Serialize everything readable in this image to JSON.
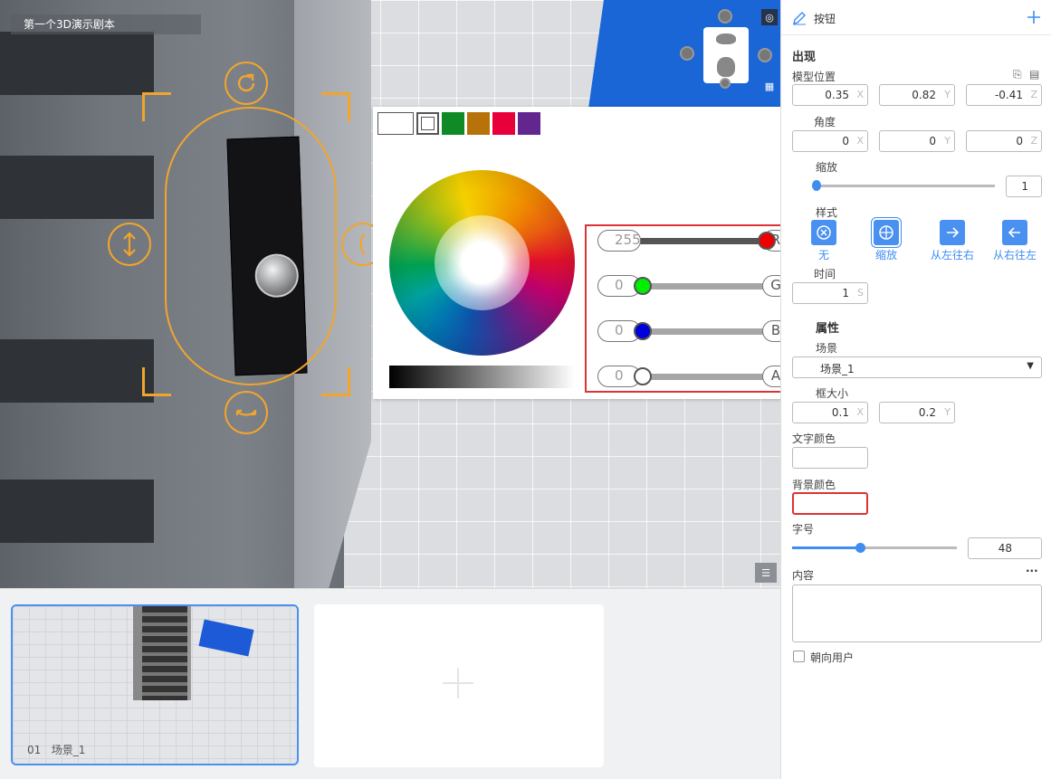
{
  "scene": {
    "title": "第一个3D演示剧本"
  },
  "color_picker": {
    "swatches": [
      "#ffffff",
      "#ffffff",
      "#0f8a26",
      "#b8720a",
      "#e8003a",
      "#62268e"
    ],
    "channels": [
      {
        "value": "255",
        "label": "R",
        "fraction": 1.0,
        "knob_color": "#ee0000"
      },
      {
        "value": "0",
        "label": "G",
        "fraction": 0.0,
        "knob_color": "#00ee00"
      },
      {
        "value": "0",
        "label": "B",
        "fraction": 0.0,
        "knob_color": "#0000dd"
      },
      {
        "value": "0",
        "label": "A",
        "fraction": 0.0,
        "knob_color": "#ffffff"
      }
    ]
  },
  "timeline": {
    "thumbs": [
      {
        "index": "01",
        "name": "场景_1"
      }
    ]
  },
  "panel": {
    "header_title": "按钮",
    "appear_title": "出现",
    "model_position_label": "模型位置",
    "position": {
      "x": "0.35",
      "y": "0.82",
      "z": "-0.41"
    },
    "angle_label": "角度",
    "angle": {
      "x": "0",
      "y": "0",
      "z": "0"
    },
    "scale_label": "缩放",
    "scale_value": "1",
    "scale_fraction": 0.0,
    "style_label": "样式",
    "styles": [
      {
        "label": "无",
        "icon": "cancel-icon"
      },
      {
        "label": "缩放",
        "icon": "move-icon"
      },
      {
        "label": "从左往右",
        "icon": "arrow-right-icon"
      },
      {
        "label": "从右往左",
        "icon": "arrow-left-icon"
      }
    ],
    "time_label": "时间",
    "time_value": "1",
    "time_unit": "S",
    "props_title": "属性",
    "scene_label": "场景",
    "scene_select": "场景_1",
    "box_size_label": "框大小",
    "box_size": {
      "x": "0.1",
      "y": "0.2"
    },
    "text_color_label": "文字颜色",
    "bg_color_label": "背景颜色",
    "font_size_label": "字号",
    "font_size_value": "48",
    "font_size_fraction": 0.41,
    "content_label": "内容",
    "content_more": "···",
    "face_user_label": "朝向用户",
    "units": {
      "x": "X",
      "y": "Y",
      "z": "Z"
    },
    "accent": "#3d8ef0",
    "highlight": "#d33333"
  }
}
